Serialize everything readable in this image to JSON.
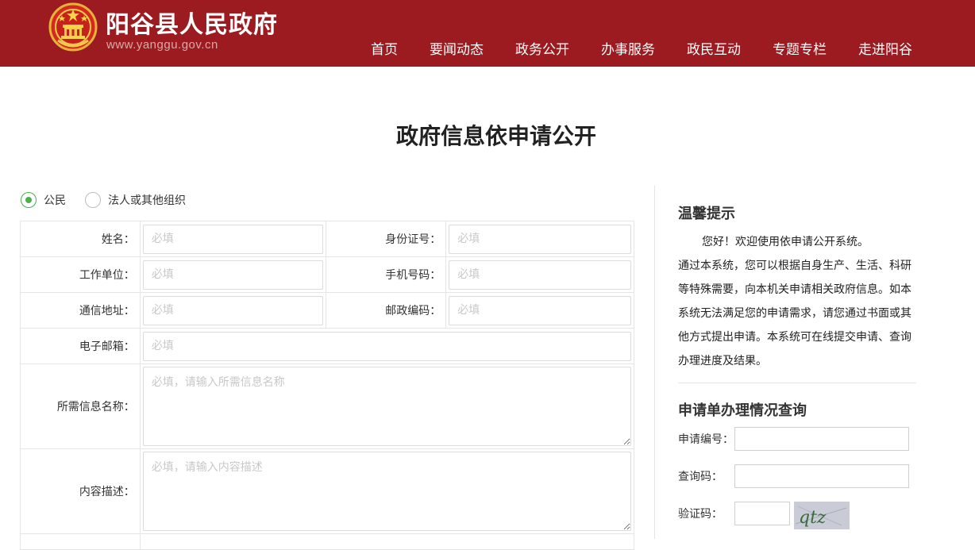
{
  "header": {
    "site_name": "阳谷县人民政府",
    "site_url": "www.yanggu.gov.cn",
    "nav": [
      "首页",
      "要闻动态",
      "政务公开",
      "办事服务",
      "政民互动",
      "专题专栏",
      "走进阳谷"
    ]
  },
  "page_title": "政府信息依申请公开",
  "applicant_type": {
    "options": [
      "公民",
      "法人或其他组织"
    ],
    "selected": "公民"
  },
  "form": {
    "name_label": "姓名：",
    "id_label": "身份证号：",
    "work_label": "工作单位：",
    "phone_label": "手机号码：",
    "address_label": "通信地址：",
    "postcode_label": "邮政编码：",
    "email_label": "电子邮箱：",
    "info_name_label": "所需信息名称：",
    "desc_label": "内容描述：",
    "required_placeholder": "必填",
    "info_name_placeholder": "必填，请输入所需信息名称",
    "desc_placeholder": "必填，请输入内容描述"
  },
  "sidebar": {
    "tips_title": "温馨提示",
    "tips_lines": [
      "您好！欢迎使用依申请公开系统。",
      "通过本系统，您可以根据自身生产、生活、科研",
      "等特殊需要，向本机关申请相关政府信息。如本",
      "系统无法满足您的申请需求，请您通过书面或其",
      "他方式提出申请。本系统可在线提交申请、查询",
      "办理进度及结果。"
    ],
    "query_title": "申请单办理情况查询",
    "app_no_label": "申请编号：",
    "query_code_label": "查询码：",
    "captcha_label": "验证码：",
    "captcha_text": "qtz"
  },
  "colors": {
    "header_bg": "#9c1b20",
    "radio_accent": "#4caf50"
  }
}
